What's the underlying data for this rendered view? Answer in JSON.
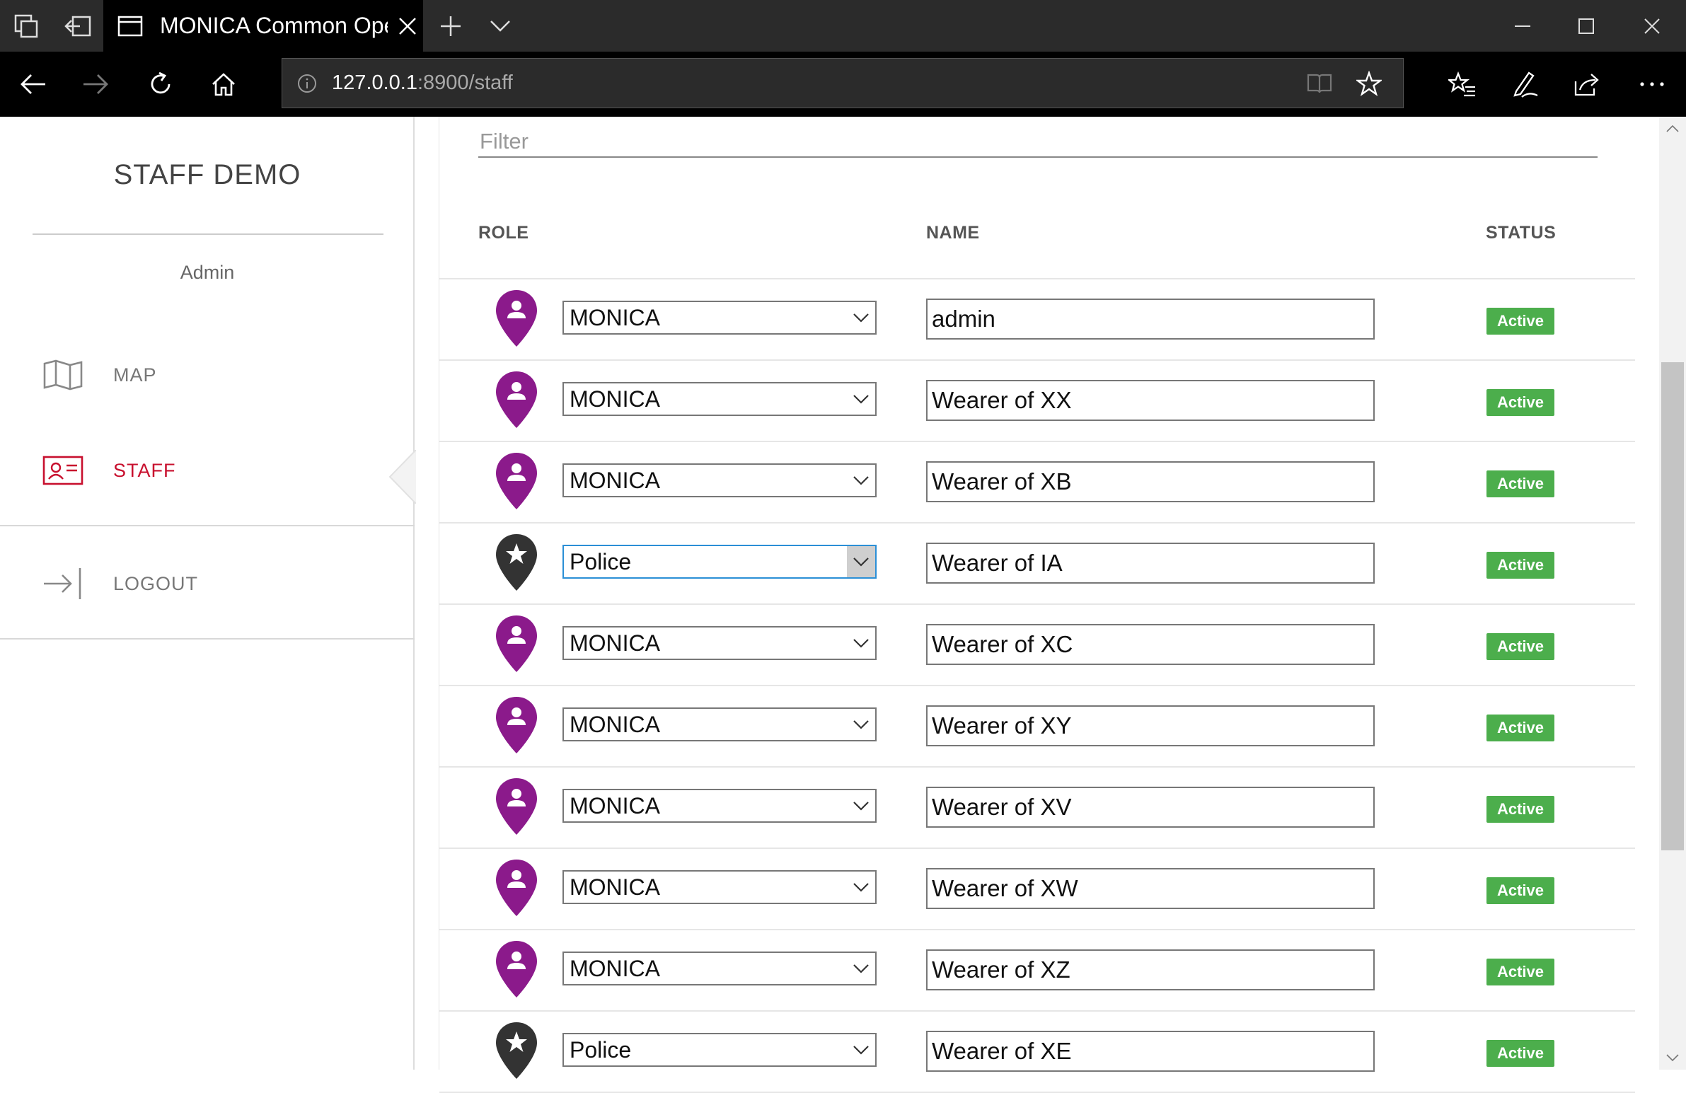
{
  "browser": {
    "tab_title": "MONICA Common Operational Picture",
    "address_host": "127.0.0.1",
    "address_path": ":8900/staff"
  },
  "sidebar": {
    "app_title": "STAFF DEMO",
    "user": "Admin",
    "items": [
      {
        "label": "MAP",
        "icon": "map-icon",
        "active": false
      },
      {
        "label": "STAFF",
        "icon": "id-card-icon",
        "active": true
      },
      {
        "label": "LOGOUT",
        "icon": "logout-icon",
        "active": false
      }
    ]
  },
  "filter": {
    "placeholder": "Filter",
    "value": ""
  },
  "table": {
    "headers": {
      "role": "ROLE",
      "name": "NAME",
      "status": "STATUS"
    },
    "rows": [
      {
        "role": "MONICA",
        "name": "admin",
        "status": "Active",
        "icon": "person-pin-icon"
      },
      {
        "role": "MONICA",
        "name": "Wearer of XX",
        "status": "Active",
        "icon": "person-pin-icon"
      },
      {
        "role": "MONICA",
        "name": "Wearer of XB",
        "status": "Active",
        "icon": "person-pin-icon"
      },
      {
        "role": "Police",
        "name": "Wearer of IA",
        "status": "Active",
        "icon": "star-pin-icon"
      },
      {
        "role": "MONICA",
        "name": "Wearer of XC",
        "status": "Active",
        "icon": "person-pin-icon"
      },
      {
        "role": "MONICA",
        "name": "Wearer of XY",
        "status": "Active",
        "icon": "person-pin-icon"
      },
      {
        "role": "MONICA",
        "name": "Wearer of XV",
        "status": "Active",
        "icon": "person-pin-icon"
      },
      {
        "role": "MONICA",
        "name": "Wearer of XW",
        "status": "Active",
        "icon": "person-pin-icon"
      },
      {
        "role": "MONICA",
        "name": "Wearer of XZ",
        "status": "Active",
        "icon": "person-pin-icon"
      },
      {
        "role": "Police",
        "name": "Wearer of XE",
        "status": "Active",
        "icon": "star-pin-icon"
      }
    ]
  },
  "colors": {
    "monica_pin": "#8b1a8b",
    "police_pin": "#333333",
    "active_badge": "#4cae4c",
    "active_nav": "#c8102e"
  }
}
